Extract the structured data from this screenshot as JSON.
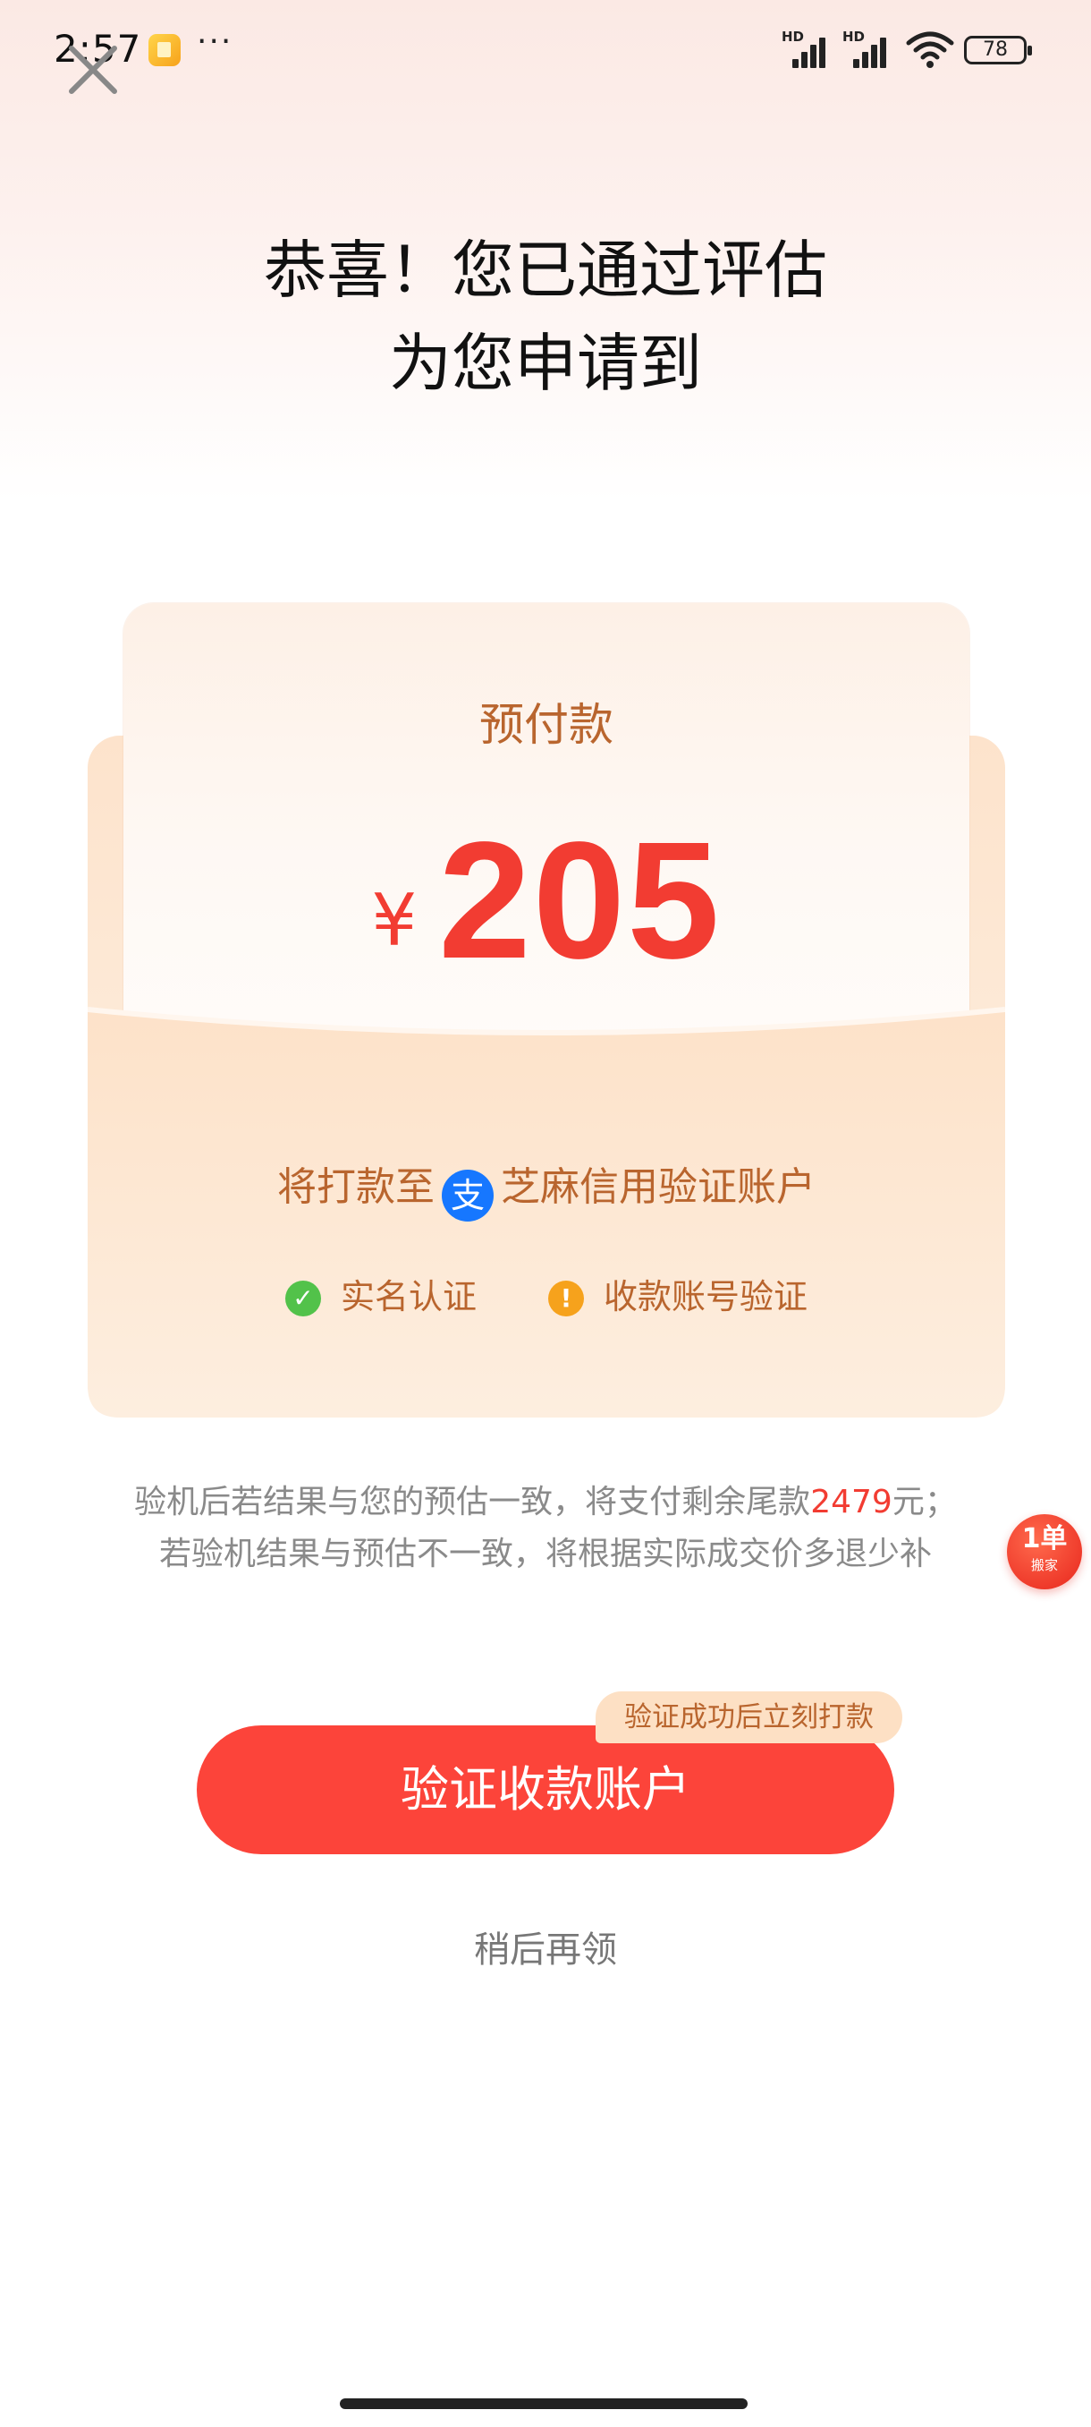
{
  "status_bar": {
    "time": "2:57",
    "more": "···",
    "signal1_label": "HD",
    "signal2_label": "HD",
    "battery": "78"
  },
  "header": {
    "title_line1": "恭喜！您已通过评估",
    "title_line2": "为您申请到"
  },
  "card": {
    "label": "预付款",
    "currency": "¥",
    "amount": "205",
    "payto_prefix": "将打款至",
    "payto_icon_char": "支",
    "payto_account": "芝麻信用验证账户",
    "check1": "实名认证",
    "check2": "收款账号验证",
    "check1_icon": "✓",
    "check2_icon": "!"
  },
  "description": {
    "line1_pre": "验机后若结果与您的预估一致，将支付剩余尾款",
    "line1_amount": "2479",
    "line1_post": "元；",
    "line2": "若验机结果与预估不一致，将根据实际成交价多退少补"
  },
  "float_badge": {
    "main": "1单",
    "sub": "搬家"
  },
  "actions": {
    "tag": "验证成功后立刻打款",
    "verify_button": "验证收款账户",
    "later": "稍后再领"
  },
  "icons": {
    "close": "close-icon",
    "alipay": "alipay-icon",
    "check_ok": "check-circle-icon",
    "check_warn": "warning-circle-icon"
  },
  "colors": {
    "accent_red": "#fc443a",
    "amount_red": "#f23c32",
    "brown_text": "#b9652e",
    "alipay_blue": "#1677ff",
    "ok_green": "#52c24a",
    "warn_orange": "#f6a21c"
  }
}
